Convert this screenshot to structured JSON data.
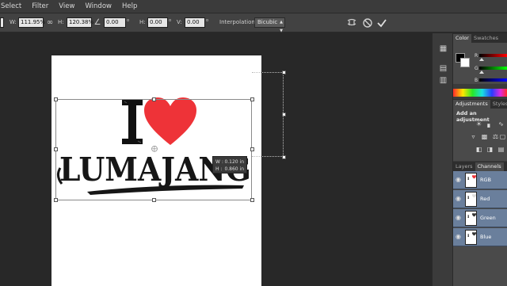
{
  "menu": [
    "Select",
    "Filter",
    "View",
    "Window",
    "Help"
  ],
  "options": {
    "w_label": "W:",
    "w_value": "111.95%",
    "link_icon": "chain-link-icon",
    "h_label": "H:",
    "h_value": "120.38%",
    "angle_value": "0.00",
    "hskew_label": "H:",
    "hskew_value": "0.00",
    "vskew_label": "V:",
    "vskew_value": "0.00",
    "interp_label": "Interpolation:",
    "interp_value": "Bicubic",
    "warp_icon": "warp-icon",
    "cancel_icon": "cancel-icon",
    "commit_icon": "commit-checkmark-icon"
  },
  "artwork": {
    "line1_letter": "I",
    "line2_text": "LUMAJANG",
    "heart_color": "#ee3338"
  },
  "info_popup": {
    "w_label": "W :",
    "w_value": "0.120 in",
    "h_label": "H :",
    "h_value": "0.860 in"
  },
  "panels": {
    "color_tabs": [
      "Color",
      "Swatches"
    ],
    "channels": [
      "R",
      "G",
      "B"
    ],
    "adj_tabs": [
      "Adjustments",
      "Styles"
    ],
    "adj_title": "Add an adjustment",
    "layer_tabs": [
      "Layers",
      "Channels"
    ],
    "channel_rows": [
      "RGB",
      "Red",
      "Green",
      "Blue"
    ],
    "selected_color": "#6a7f9c"
  }
}
